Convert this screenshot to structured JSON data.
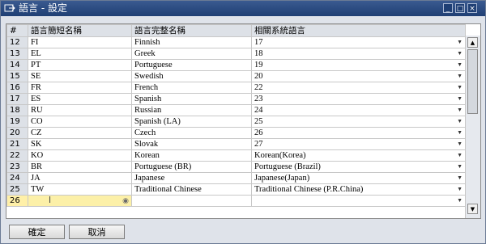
{
  "window": {
    "title": "語言 - 設定"
  },
  "grid": {
    "columns": [
      "#",
      "語言簡短名稱",
      "語言完整名稱",
      "相關系統語言"
    ],
    "rows": [
      {
        "num": "12",
        "code": "FI",
        "name": "Finnish",
        "system": "17"
      },
      {
        "num": "13",
        "code": "EL",
        "name": "Greek",
        "system": "18"
      },
      {
        "num": "14",
        "code": "PT",
        "name": "Portuguese",
        "system": "19"
      },
      {
        "num": "15",
        "code": "SE",
        "name": "Swedish",
        "system": "20"
      },
      {
        "num": "16",
        "code": "FR",
        "name": "French",
        "system": "22"
      },
      {
        "num": "17",
        "code": "ES",
        "name": "Spanish",
        "system": "23"
      },
      {
        "num": "18",
        "code": "RU",
        "name": "Russian",
        "system": "24"
      },
      {
        "num": "19",
        "code": "CO",
        "name": "Spanish (LA)",
        "system": "25"
      },
      {
        "num": "20",
        "code": "CZ",
        "name": "Czech",
        "system": "26"
      },
      {
        "num": "21",
        "code": "SK",
        "name": "Slovak",
        "system": "27"
      },
      {
        "num": "22",
        "code": "KO",
        "name": "Korean",
        "system": "Korean(Korea)"
      },
      {
        "num": "23",
        "code": "BR",
        "name": "Portuguese (BR)",
        "system": "Portuguese (Brazil)"
      },
      {
        "num": "24",
        "code": "JA",
        "name": "Japanese",
        "system": "Japanese(Japan)"
      },
      {
        "num": "25",
        "code": "TW",
        "name": "Traditional Chinese",
        "system": "Traditional Chinese (P.R.China)"
      },
      {
        "num": "26",
        "code": "",
        "name": "",
        "system": ""
      }
    ]
  },
  "buttons": {
    "ok": "確定",
    "cancel": "取消"
  },
  "icons": {
    "title": "window-menu-icon",
    "dropdown": "dropdown-arrow-icon",
    "lookup": "lookup-icon",
    "cursor": "text-cursor-icon",
    "scroll_up": "scroll-up-icon",
    "scroll_down": "scroll-down-icon"
  },
  "colors": {
    "titlebar": "#1f3f74",
    "active_cell": "#fcf0a8",
    "header": "#dde1e7"
  }
}
